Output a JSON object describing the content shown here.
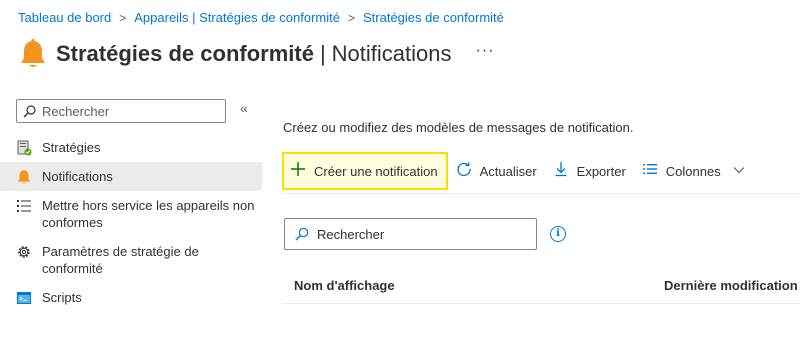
{
  "breadcrumb": [
    {
      "label": "Tableau de bord"
    },
    {
      "label": "Appareils | Stratégies de conformité"
    },
    {
      "label": "Stratégies de conformité"
    }
  ],
  "header": {
    "title": "Stratégies de conformité",
    "separator": "|",
    "subtitle": "Notifications",
    "more": "···"
  },
  "sidebar": {
    "search_placeholder": "Rechercher",
    "collapse": "«",
    "items": [
      {
        "label": "Stratégies",
        "icon": "policy-icon"
      },
      {
        "label": "Notifications",
        "icon": "bell-icon",
        "active": true
      },
      {
        "label": "Mettre hors service les appareils non conformes",
        "icon": "list-icon"
      },
      {
        "label": "Paramètres de stratégie de conformité",
        "icon": "gear-icon"
      },
      {
        "label": "Scripts",
        "icon": "script-icon"
      }
    ]
  },
  "main": {
    "description": "Créez ou modifiez des modèles de messages de notification.",
    "toolbar": {
      "create": "Créer une notification",
      "refresh": "Actualiser",
      "export": "Exporter",
      "columns": "Colonnes"
    },
    "search_placeholder": "Rechercher",
    "info": "i",
    "table": {
      "columns": [
        "Nom d'affichage",
        "Dernière modification"
      ]
    }
  },
  "colors": {
    "accent": "#0078d4",
    "bell": "#f7941d",
    "highlight": "#fce100",
    "active_bg": "#edebe9"
  }
}
